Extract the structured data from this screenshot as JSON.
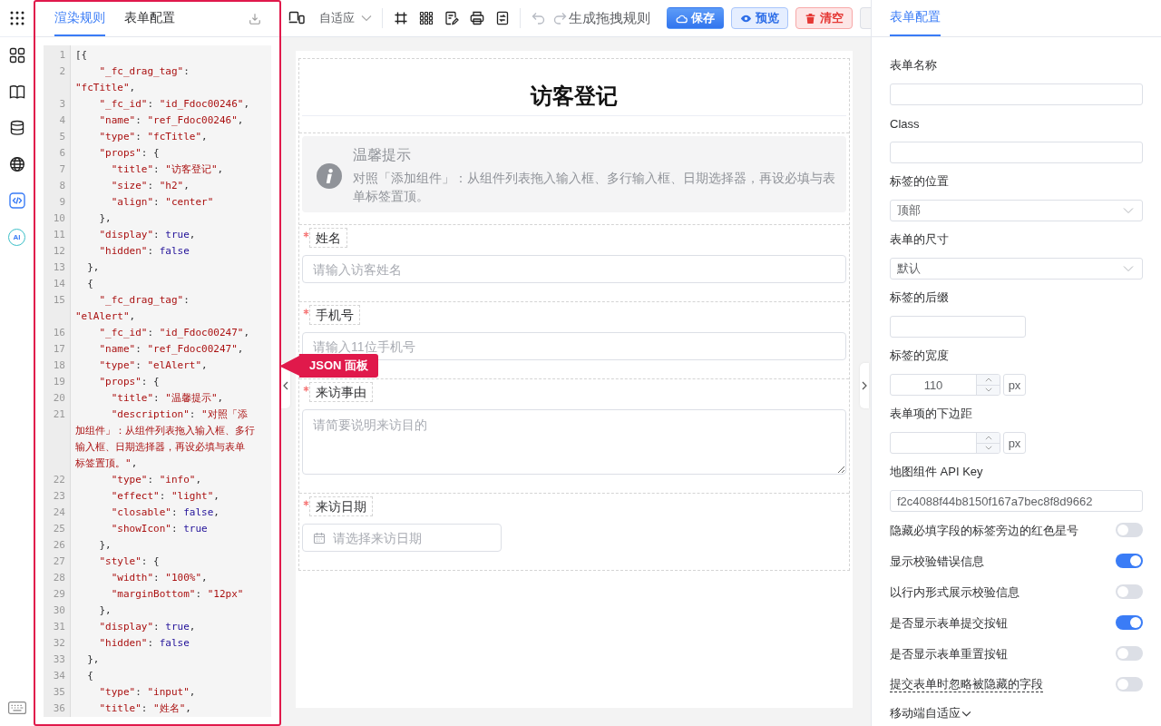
{
  "rail": {
    "items": [
      {
        "selected": false
      },
      {
        "selected": false
      },
      {
        "selected": false
      },
      {
        "selected": false
      },
      {
        "selected": true
      },
      {
        "selected": false,
        "label": "AI"
      }
    ]
  },
  "json_panel": {
    "tabs": [
      {
        "label": "渲染规则",
        "selected": true
      },
      {
        "label": "表单配置",
        "selected": false
      }
    ],
    "code": [
      {
        "number": "1",
        "tokens": [
          {
            "kind": "punct",
            "text": "[{"
          }
        ]
      },
      {
        "number": "2",
        "tokens": [
          {
            "kind": "string",
            "text": "    \"_fc_drag_tag\""
          },
          {
            "kind": "punct",
            "text": ":"
          }
        ]
      },
      {
        "tokens": [
          {
            "kind": "string",
            "text": "\"fcTitle\""
          },
          {
            "kind": "punct",
            "text": ","
          }
        ]
      },
      {
        "number": "3",
        "tokens": [
          {
            "kind": "string",
            "text": "    \"_fc_id\""
          },
          {
            "kind": "punct",
            "text": ": "
          },
          {
            "kind": "string",
            "text": "\"id_Fdoc00246\""
          },
          {
            "kind": "punct",
            "text": ","
          }
        ]
      },
      {
        "number": "4",
        "tokens": [
          {
            "kind": "string",
            "text": "    \"name\""
          },
          {
            "kind": "punct",
            "text": ": "
          },
          {
            "kind": "string",
            "text": "\"ref_Fdoc00246\""
          },
          {
            "kind": "punct",
            "text": ","
          }
        ]
      },
      {
        "number": "5",
        "tokens": [
          {
            "kind": "string",
            "text": "    \"type\""
          },
          {
            "kind": "punct",
            "text": ": "
          },
          {
            "kind": "string",
            "text": "\"fcTitle\""
          },
          {
            "kind": "punct",
            "text": ","
          }
        ]
      },
      {
        "number": "6",
        "tokens": [
          {
            "kind": "string",
            "text": "    \"props\""
          },
          {
            "kind": "punct",
            "text": ": {"
          }
        ]
      },
      {
        "number": "7",
        "tokens": [
          {
            "kind": "string",
            "text": "      \"title\""
          },
          {
            "kind": "punct",
            "text": ": "
          },
          {
            "kind": "string",
            "text": "\"访客登记\""
          },
          {
            "kind": "punct",
            "text": ","
          }
        ]
      },
      {
        "number": "8",
        "tokens": [
          {
            "kind": "string",
            "text": "      \"size\""
          },
          {
            "kind": "punct",
            "text": ": "
          },
          {
            "kind": "string",
            "text": "\"h2\""
          },
          {
            "kind": "punct",
            "text": ","
          }
        ]
      },
      {
        "number": "9",
        "tokens": [
          {
            "kind": "string",
            "text": "      \"align\""
          },
          {
            "kind": "punct",
            "text": ": "
          },
          {
            "kind": "string",
            "text": "\"center\""
          }
        ]
      },
      {
        "number": "10",
        "tokens": [
          {
            "kind": "punct",
            "text": "    },"
          }
        ]
      },
      {
        "number": "11",
        "tokens": [
          {
            "kind": "string",
            "text": "    \"display\""
          },
          {
            "kind": "punct",
            "text": ": "
          },
          {
            "kind": "atom",
            "text": "true"
          },
          {
            "kind": "punct",
            "text": ","
          }
        ]
      },
      {
        "number": "12",
        "tokens": [
          {
            "kind": "string",
            "text": "    \"hidden\""
          },
          {
            "kind": "punct",
            "text": ": "
          },
          {
            "kind": "atom",
            "text": "false"
          }
        ]
      },
      {
        "number": "13",
        "tokens": [
          {
            "kind": "punct",
            "text": "  },"
          }
        ]
      },
      {
        "number": "14",
        "tokens": [
          {
            "kind": "punct",
            "text": "  {"
          }
        ]
      },
      {
        "number": "15",
        "tokens": [
          {
            "kind": "string",
            "text": "    \"_fc_drag_tag\""
          },
          {
            "kind": "punct",
            "text": ":"
          }
        ]
      },
      {
        "tokens": [
          {
            "kind": "string",
            "text": "\"elAlert\""
          },
          {
            "kind": "punct",
            "text": ","
          }
        ]
      },
      {
        "number": "16",
        "tokens": [
          {
            "kind": "string",
            "text": "    \"_fc_id\""
          },
          {
            "kind": "punct",
            "text": ": "
          },
          {
            "kind": "string",
            "text": "\"id_Fdoc00247\""
          },
          {
            "kind": "punct",
            "text": ","
          }
        ]
      },
      {
        "number": "17",
        "tokens": [
          {
            "kind": "string",
            "text": "    \"name\""
          },
          {
            "kind": "punct",
            "text": ": "
          },
          {
            "kind": "string",
            "text": "\"ref_Fdoc00247\""
          },
          {
            "kind": "punct",
            "text": ","
          }
        ]
      },
      {
        "number": "18",
        "tokens": [
          {
            "kind": "string",
            "text": "    \"type\""
          },
          {
            "kind": "punct",
            "text": ": "
          },
          {
            "kind": "string",
            "text": "\"elAlert\""
          },
          {
            "kind": "punct",
            "text": ","
          }
        ]
      },
      {
        "number": "19",
        "tokens": [
          {
            "kind": "string",
            "text": "    \"props\""
          },
          {
            "kind": "punct",
            "text": ": {"
          }
        ]
      },
      {
        "number": "20",
        "tokens": [
          {
            "kind": "string",
            "text": "      \"title\""
          },
          {
            "kind": "punct",
            "text": ": "
          },
          {
            "kind": "string",
            "text": "\"温馨提示\""
          },
          {
            "kind": "punct",
            "text": ","
          }
        ]
      },
      {
        "number": "21",
        "tokens": [
          {
            "kind": "string",
            "text": "      \"description\""
          },
          {
            "kind": "punct",
            "text": ": "
          },
          {
            "kind": "string",
            "text": "\"对照「添"
          }
        ]
      },
      {
        "tokens": [
          {
            "kind": "string",
            "text": "加组件」：从组件列表拖入输入框、多行"
          }
        ]
      },
      {
        "tokens": [
          {
            "kind": "string",
            "text": "输入框、日期选择器，再设必填与表单"
          }
        ]
      },
      {
        "tokens": [
          {
            "kind": "string",
            "text": "标签置顶。\""
          },
          {
            "kind": "punct",
            "text": ","
          }
        ]
      },
      {
        "number": "22",
        "tokens": [
          {
            "kind": "string",
            "text": "      \"type\""
          },
          {
            "kind": "punct",
            "text": ": "
          },
          {
            "kind": "string",
            "text": "\"info\""
          },
          {
            "kind": "punct",
            "text": ","
          }
        ]
      },
      {
        "number": "23",
        "tokens": [
          {
            "kind": "string",
            "text": "      \"effect\""
          },
          {
            "kind": "punct",
            "text": ": "
          },
          {
            "kind": "string",
            "text": "\"light\""
          },
          {
            "kind": "punct",
            "text": ","
          }
        ]
      },
      {
        "number": "24",
        "tokens": [
          {
            "kind": "string",
            "text": "      \"closable\""
          },
          {
            "kind": "punct",
            "text": ": "
          },
          {
            "kind": "atom",
            "text": "false"
          },
          {
            "kind": "punct",
            "text": ","
          }
        ]
      },
      {
        "number": "25",
        "tokens": [
          {
            "kind": "string",
            "text": "      \"showIcon\""
          },
          {
            "kind": "punct",
            "text": ": "
          },
          {
            "kind": "atom",
            "text": "true"
          }
        ]
      },
      {
        "number": "26",
        "tokens": [
          {
            "kind": "punct",
            "text": "    },"
          }
        ]
      },
      {
        "number": "27",
        "tokens": [
          {
            "kind": "string",
            "text": "    \"style\""
          },
          {
            "kind": "punct",
            "text": ": {"
          }
        ]
      },
      {
        "number": "28",
        "tokens": [
          {
            "kind": "string",
            "text": "      \"width\""
          },
          {
            "kind": "punct",
            "text": ": "
          },
          {
            "kind": "string",
            "text": "\"100%\""
          },
          {
            "kind": "punct",
            "text": ","
          }
        ]
      },
      {
        "number": "29",
        "tokens": [
          {
            "kind": "string",
            "text": "      \"marginBottom\""
          },
          {
            "kind": "punct",
            "text": ": "
          },
          {
            "kind": "string",
            "text": "\"12px\""
          }
        ]
      },
      {
        "number": "30",
        "tokens": [
          {
            "kind": "punct",
            "text": "    },"
          }
        ]
      },
      {
        "number": "31",
        "tokens": [
          {
            "kind": "string",
            "text": "    \"display\""
          },
          {
            "kind": "punct",
            "text": ": "
          },
          {
            "kind": "atom",
            "text": "true"
          },
          {
            "kind": "punct",
            "text": ","
          }
        ]
      },
      {
        "number": "32",
        "tokens": [
          {
            "kind": "string",
            "text": "    \"hidden\""
          },
          {
            "kind": "punct",
            "text": ": "
          },
          {
            "kind": "atom",
            "text": "false"
          }
        ]
      },
      {
        "number": "33",
        "tokens": [
          {
            "kind": "punct",
            "text": "  },"
          }
        ]
      },
      {
        "number": "34",
        "tokens": [
          {
            "kind": "punct",
            "text": "  {"
          }
        ]
      },
      {
        "number": "35",
        "tokens": [
          {
            "kind": "string",
            "text": "    \"type\""
          },
          {
            "kind": "punct",
            "text": ": "
          },
          {
            "kind": "string",
            "text": "\"input\""
          },
          {
            "kind": "punct",
            "text": ","
          }
        ]
      },
      {
        "number": "36",
        "tokens": [
          {
            "kind": "string",
            "text": "    \"title\""
          },
          {
            "kind": "punct",
            "text": ": "
          },
          {
            "kind": "string",
            "text": "\"姓名\""
          },
          {
            "kind": "punct",
            "text": ","
          }
        ]
      }
    ]
  },
  "callout": {
    "text": "JSON 面板"
  },
  "toolbar": {
    "device": "自适应",
    "undo": {
      "disabled": true
    },
    "redo": {
      "disabled": true
    },
    "generate": "生成拖拽规则",
    "buttons": [
      {
        "kind": "primary",
        "label": "保存"
      },
      {
        "kind": "info",
        "label": "预览"
      },
      {
        "kind": "danger",
        "label": "清空"
      },
      {
        "kind": "plain"
      }
    ]
  },
  "canvas": {
    "title": "访客登记",
    "alert": {
      "title": "温馨提示",
      "description": "对照「添加组件」：从组件列表拖入输入框、多行输入框、日期选择器，再设必填与表单标签置顶。"
    },
    "fields": [
      {
        "kind": "input",
        "label": "姓名",
        "required": true,
        "placeholder": "请输入访客姓名"
      },
      {
        "kind": "input",
        "label": "手机号",
        "required": true,
        "placeholder": "请输入11位手机号"
      },
      {
        "kind": "textarea",
        "label": "来访事由",
        "required": true,
        "placeholder": "请简要说明来访目的"
      },
      {
        "kind": "date",
        "label": "来访日期",
        "required": true,
        "placeholder": "请选择来访日期"
      }
    ]
  },
  "config": {
    "tabs": [
      {
        "label": "表单配置",
        "selected": true
      }
    ],
    "fields": [
      {
        "kind": "text",
        "label": "表单名称"
      },
      {
        "kind": "text",
        "label": "Class"
      },
      {
        "kind": "select",
        "label": "标签的位置",
        "value": "顶部"
      },
      {
        "kind": "select",
        "label": "表单的尺寸",
        "value": "默认"
      },
      {
        "kind": "short",
        "label": "标签的后缀"
      },
      {
        "kind": "number",
        "label": "标签的宽度",
        "value": "110",
        "unit": "px"
      },
      {
        "kind": "number",
        "label": "表单项的下边距",
        "unit": "px"
      },
      {
        "kind": "text",
        "label": "地图组件 API Key",
        "value": "f2c4088f44b8150f167a7bec8f8d9662"
      }
    ],
    "switches": [
      {
        "label": "隐藏必填字段的标签旁边的红色星号",
        "on": false,
        "tooltip": false
      },
      {
        "label": "显示校验错误信息",
        "on": true,
        "tooltip": false
      },
      {
        "label": "以行内形式展示校验信息",
        "on": false,
        "tooltip": false
      },
      {
        "label": "是否显示表单提交按钮",
        "on": true,
        "tooltip": false
      },
      {
        "label": "是否显示表单重置按钮",
        "on": false,
        "tooltip": false
      },
      {
        "label": "提交表单时忽略被隐藏的字段",
        "on": false,
        "tooltip": true
      }
    ],
    "collapse": {
      "label": "移动端自适应",
      "expanded": false
    }
  }
}
